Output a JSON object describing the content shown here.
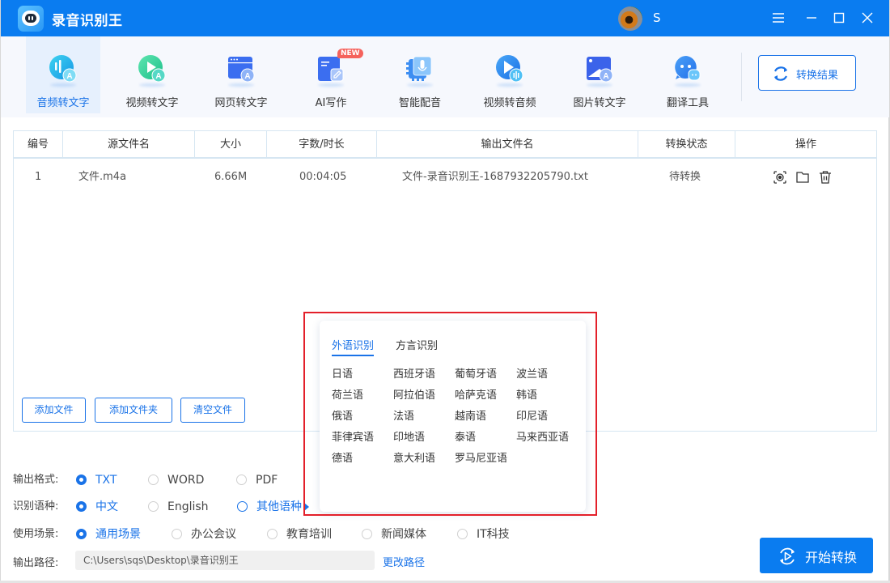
{
  "app": {
    "title": "录音识别王",
    "username": "S"
  },
  "window_controls": {
    "menu": "menu-icon",
    "minimize": "minimize-icon",
    "maximize": "maximize-icon",
    "close": "close-icon"
  },
  "toolbar": {
    "tools": [
      {
        "label": "音频转文字",
        "icon": "audio-to-text-icon",
        "active": true
      },
      {
        "label": "视频转文字",
        "icon": "video-to-text-icon",
        "active": false
      },
      {
        "label": "网页转文字",
        "icon": "webpage-to-text-icon",
        "active": false
      },
      {
        "label": "AI写作",
        "icon": "ai-writing-icon",
        "active": false,
        "badge": "NEW"
      },
      {
        "label": "智能配音",
        "icon": "smart-dubbing-icon",
        "active": false
      },
      {
        "label": "视频转音频",
        "icon": "video-to-audio-icon",
        "active": false
      },
      {
        "label": "图片转文字",
        "icon": "image-to-text-icon",
        "active": false
      },
      {
        "label": "翻译工具",
        "icon": "translate-icon",
        "active": false
      }
    ],
    "result_button": "转换结果"
  },
  "table": {
    "headers": [
      "编号",
      "源文件名",
      "大小",
      "字数/时长",
      "输出文件名",
      "转换状态",
      "操作"
    ],
    "rows": [
      {
        "index": "1",
        "source": "文件.m4a",
        "size": "6.66M",
        "duration": "00:04:05",
        "output": "文件-录音识别王-1687932205790.txt",
        "status": "待转换",
        "actions": [
          "preview-icon",
          "folder-icon",
          "delete-icon"
        ]
      }
    ]
  },
  "file_buttons": {
    "add_file": "添加文件",
    "add_folder": "添加文件夹",
    "clear": "清空文件"
  },
  "options": {
    "format": {
      "label": "输出格式:",
      "choices": [
        "TXT",
        "WORD",
        "PDF"
      ],
      "selected": "TXT"
    },
    "language": {
      "label": "识别语种:",
      "choices": [
        "中文",
        "English"
      ],
      "other": "其他语种",
      "selected": "中文"
    },
    "scene": {
      "label": "使用场景:",
      "choices": [
        "通用场景",
        "办公会议",
        "教育培训",
        "新闻媒体",
        "IT科技"
      ],
      "selected": "通用场景"
    },
    "path": {
      "label": "输出路径:",
      "value": "C:\\Users\\sqs\\Desktop\\录音识别王",
      "change": "更改路径"
    }
  },
  "start_button": "开始转换",
  "language_popup": {
    "tabs": [
      "外语识别",
      "方言识别"
    ],
    "active_tab": "外语识别",
    "languages": [
      [
        "日语",
        "西班牙语",
        "葡萄牙语",
        "波兰语"
      ],
      [
        "荷兰语",
        "阿拉伯语",
        "哈萨克语",
        "韩语"
      ],
      [
        "俄语",
        "法语",
        "越南语",
        "印尼语"
      ],
      [
        "菲律宾语",
        "印地语",
        "泰语",
        "马来西亚语"
      ],
      [
        "德语",
        "意大利语",
        "罗马尼亚语"
      ]
    ]
  },
  "colors": {
    "brand": "#0a7cf0",
    "accent": "#1a73e8",
    "highlight": "#e3202a",
    "badge": "#f5625c"
  }
}
